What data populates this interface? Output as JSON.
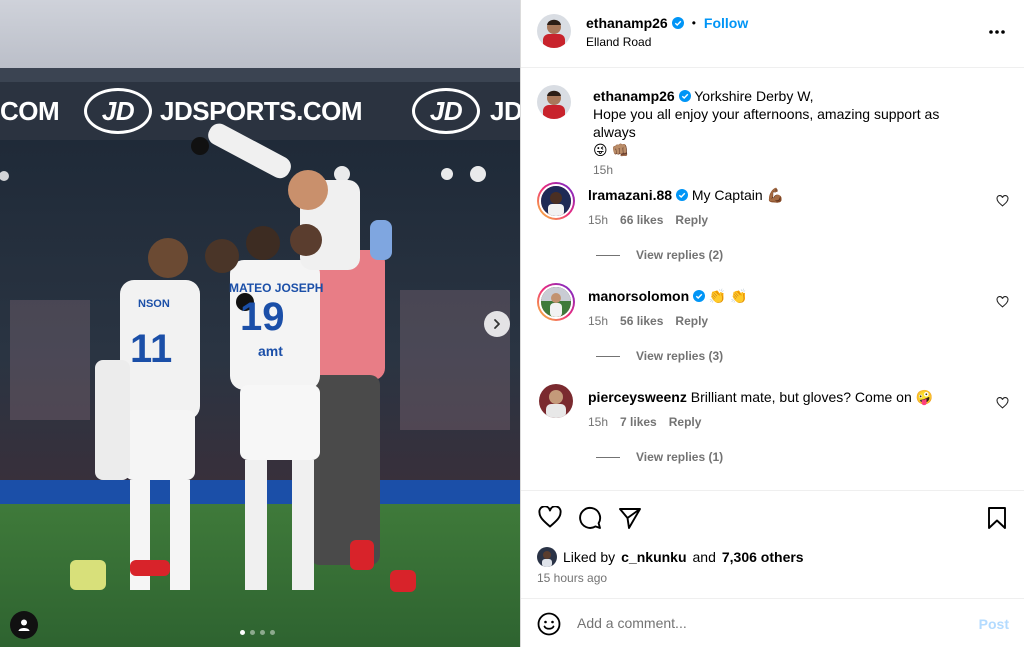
{
  "post": {
    "username": "ethanamp26",
    "follow_label": "Follow",
    "location": "Elland Road",
    "caption_line1": "Yorkshire Derby W,",
    "caption_line2": "Hope you all enjoy your afternoons, amazing support as always",
    "caption_emojis": "😜 👊🏽",
    "caption_time": "15h"
  },
  "media": {
    "board_text_left": "COM",
    "board_text_main": "JDSPORTS.COM",
    "board_text_right": "JD",
    "board_logo": "JD",
    "carousel_count": 4,
    "carousel_active": 0
  },
  "comments": [
    {
      "username": "lramazani.88",
      "text": "My Captain 💪🏾",
      "time": "15h",
      "likes": "66 likes",
      "reply": "Reply",
      "view_replies": "View replies (2)",
      "verified": true
    },
    {
      "username": "manorsolomon",
      "text": "👏 👏",
      "time": "15h",
      "likes": "56 likes",
      "reply": "Reply",
      "view_replies": "View replies (3)",
      "verified": true
    },
    {
      "username": "pierceysweenz",
      "text": "Brilliant mate, but gloves? Come on 🤪",
      "time": "15h",
      "likes": "7 likes",
      "reply": "Reply",
      "view_replies": "View replies (1)",
      "verified": false
    }
  ],
  "likes": {
    "prefix": "Liked by",
    "user": "c_nkunku",
    "and": "and",
    "others": "7,306 others"
  },
  "posted_ago": "15 hours ago",
  "composer": {
    "placeholder": "Add a comment...",
    "post_label": "Post"
  },
  "colors": {
    "accent": "#0095f6",
    "verified": "#0095f6",
    "muted": "#737373",
    "post_disabled": "#b3dbff"
  }
}
